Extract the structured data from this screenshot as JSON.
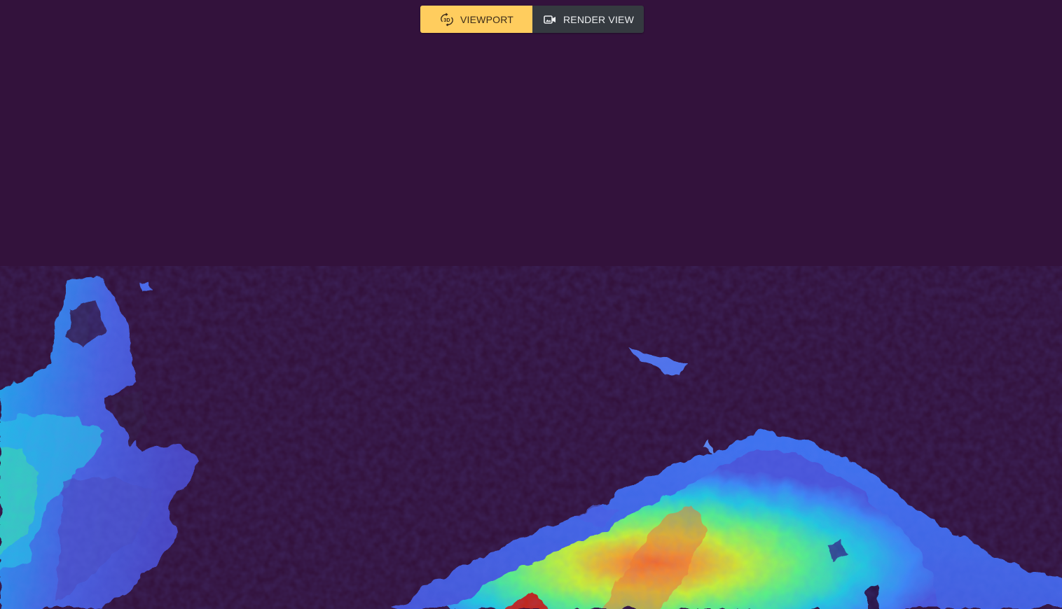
{
  "toolbar": {
    "viewport_label": "VIEWPORT",
    "viewport_icon": "rotate-3d-icon",
    "viewport_active": true,
    "render_label": "RENDER VIEW",
    "render_icon": "video-camera-icon",
    "render_active": false
  },
  "colors": {
    "background": "#33123c",
    "viewport_active_bg": "#ffcd5e",
    "render_inactive_bg": "#353a40"
  },
  "scene": {
    "colormap": "turbo"
  }
}
